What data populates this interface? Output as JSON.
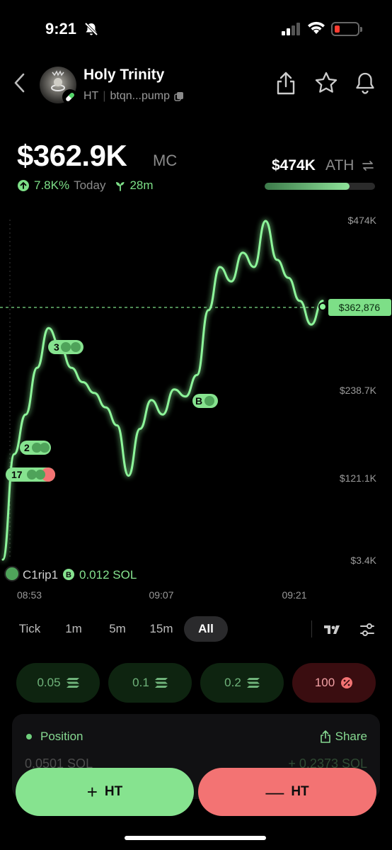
{
  "status_bar": {
    "time": "9:21"
  },
  "header": {
    "token_name": "Holy Trinity",
    "ticker": "HT",
    "address": "btqn...pump"
  },
  "market": {
    "market_cap": "$362.9K",
    "market_cap_label": "MC",
    "change_pct": "7.8K%",
    "change_period": "Today",
    "age": "28m",
    "ath_value": "$474K",
    "ath_label": "ATH",
    "ath_progress": 0.77
  },
  "chart": {
    "price_axis": [
      "$474K",
      "$238.7K",
      "$121.1K",
      "$3.4K"
    ],
    "current_price_tag": "$362,876",
    "time_axis": [
      "08:53",
      "09:07",
      "09:21"
    ],
    "trade_markers": [
      {
        "label": "3"
      },
      {
        "label": "2"
      },
      {
        "label": "17"
      },
      {
        "label": "B"
      }
    ],
    "trader": {
      "name": "C1rip1",
      "badge": "B",
      "amount": "0.012 SOL"
    },
    "line_color": "#8df59a"
  },
  "chart_data": {
    "type": "line",
    "x": [
      "08:53",
      "08:54",
      "08:55",
      "08:56",
      "08:57",
      "08:58",
      "08:59",
      "09:00",
      "09:01",
      "09:02",
      "09:03",
      "09:04",
      "09:05",
      "09:06",
      "09:07",
      "09:08",
      "09:09",
      "09:10",
      "09:11",
      "09:12",
      "09:13",
      "09:14",
      "09:15",
      "09:16",
      "09:17",
      "09:18",
      "09:19",
      "09:20",
      "09:21"
    ],
    "series": [
      {
        "values": [
          3.4,
          150,
          205,
          270,
          325,
          300,
          270,
          250,
          235,
          215,
          190,
          120,
          185,
          225,
          205,
          240,
          230,
          260,
          350,
          410,
          390,
          430,
          410,
          474,
          420,
          395,
          362.9,
          330,
          362.9
        ]
      }
    ],
    "y_ticks": [
      "$474K",
      "$238.7K",
      "$121.1K",
      "$3.4K"
    ],
    "x_ticks": [
      "08:53",
      "09:07",
      "09:21"
    ],
    "ylim": [
      3.4,
      474
    ]
  },
  "timeframes": [
    "Tick",
    "1m",
    "5m",
    "15m",
    "All"
  ],
  "active_timeframe": "All",
  "quick_buy": [
    "0.05",
    "0.1",
    "0.2"
  ],
  "quick_sell": "100",
  "position": {
    "title": "Position",
    "share": "Share",
    "amount": "0.0501 SOL",
    "pnl": "+ 0.2373 SOL"
  },
  "actions": {
    "buy_label": "HT",
    "sell_label": "HT"
  },
  "colors": {
    "green": "#86e38f",
    "red": "#f37373",
    "bg": "#000000"
  }
}
